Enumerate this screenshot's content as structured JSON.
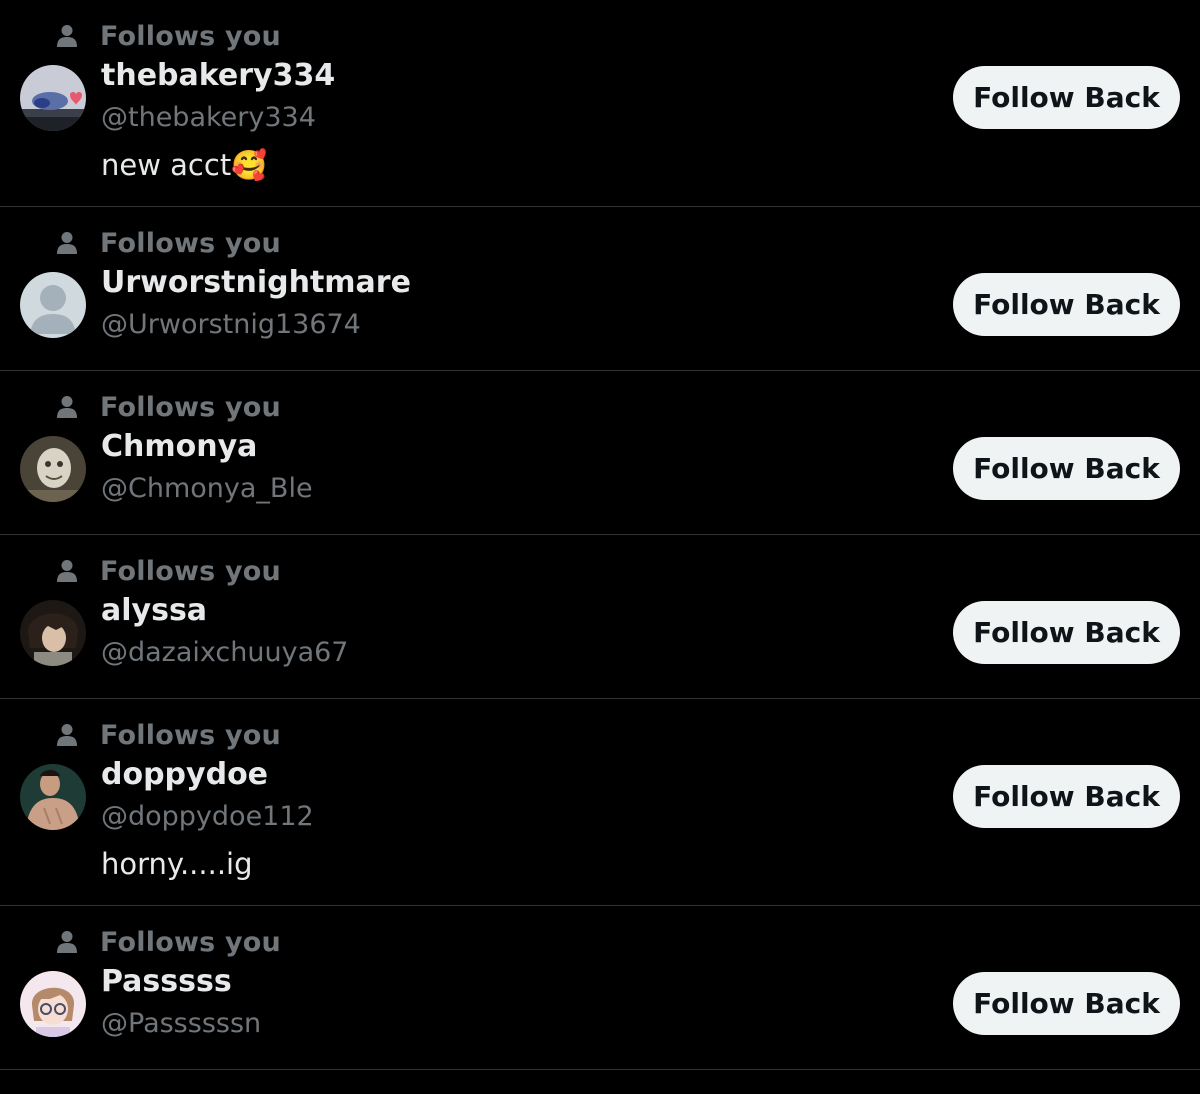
{
  "follows_label": "Follows you",
  "follow_back_label": "Follow Back",
  "colors": {
    "background": "#000000",
    "divider": "#2f3336",
    "primary_text": "#e7e9ea",
    "secondary_text": "#71767b",
    "button_bg": "#eff3f4",
    "button_text": "#0f1419"
  },
  "users": [
    {
      "name": "thebakery334",
      "handle": "@thebakery334",
      "bio": "new acct🥰",
      "avatar": "photo-avatar"
    },
    {
      "name": "Urworstnightmare",
      "handle": "@Urworstnig13674",
      "bio": "",
      "avatar": "default-avatar"
    },
    {
      "name": "Chmonya",
      "handle": "@Chmonya_Ble",
      "bio": "",
      "avatar": "photo-avatar"
    },
    {
      "name": "alyssa",
      "handle": "@dazaixchuuya67",
      "bio": "",
      "avatar": "anime-avatar"
    },
    {
      "name": "doppydoe",
      "handle": "@doppydoe112",
      "bio": "horny.....ig",
      "avatar": "photo-avatar"
    },
    {
      "name": "Passsss",
      "handle": "@Passssssn",
      "bio": "",
      "avatar": "anime-avatar"
    }
  ]
}
